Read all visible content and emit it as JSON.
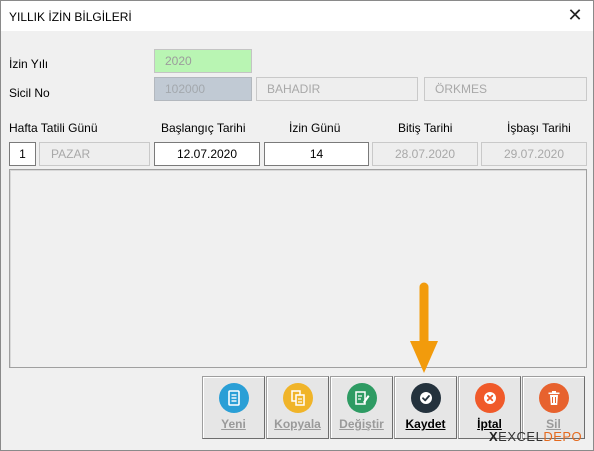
{
  "window": {
    "title": "YILLIK İZİN BİLGİLERİ",
    "close_glyph": "✕"
  },
  "form": {
    "izin_yili": {
      "label": "İzin Yılı",
      "value": "2020"
    },
    "sicil": {
      "label": "Sicil No",
      "no": "102000",
      "first_name": "BAHADIR",
      "last_name": "ÖRKMES"
    }
  },
  "columns": {
    "hafta_tatili": "Hafta Tatili Günü",
    "baslangic": "Başlangıç Tarihi",
    "izin_gunu": "İzin Günü",
    "bitis": "Bitiş Tarihi",
    "isbasi": "İşbaşı Tarihi"
  },
  "row": {
    "day_no": "1",
    "day_name": "PAZAR",
    "baslangic": "12.07.2020",
    "izin_gunu": "14",
    "bitis": "28.07.2020",
    "isbasi": "29.07.2020"
  },
  "buttons": [
    {
      "label": "Yeni",
      "icon": "document-icon",
      "color": "#2a9fd6",
      "enabled": false
    },
    {
      "label": "Kopyala",
      "icon": "copy-icon",
      "color": "#f0b429",
      "enabled": false
    },
    {
      "label": "Değiştir",
      "icon": "edit-icon",
      "color": "#2e9b63",
      "enabled": false
    },
    {
      "label": "Kaydet",
      "icon": "check-icon",
      "color": "#24323d",
      "enabled": true
    },
    {
      "label": "İptal",
      "icon": "cancel-icon",
      "color": "#f05a2a",
      "enabled": true
    },
    {
      "label": "Sil",
      "icon": "trash-icon",
      "color": "#e7622e",
      "enabled": false
    }
  ],
  "annotation": {
    "arrow_color": "#f29b0c"
  },
  "watermark": {
    "x": "X",
    "left": "EXCEL",
    "right": "DEPO"
  },
  "colors": {
    "accent_green": "#b9f5b3",
    "field_blue": "#c1cad4",
    "window_bg": "#f0f0f0"
  }
}
